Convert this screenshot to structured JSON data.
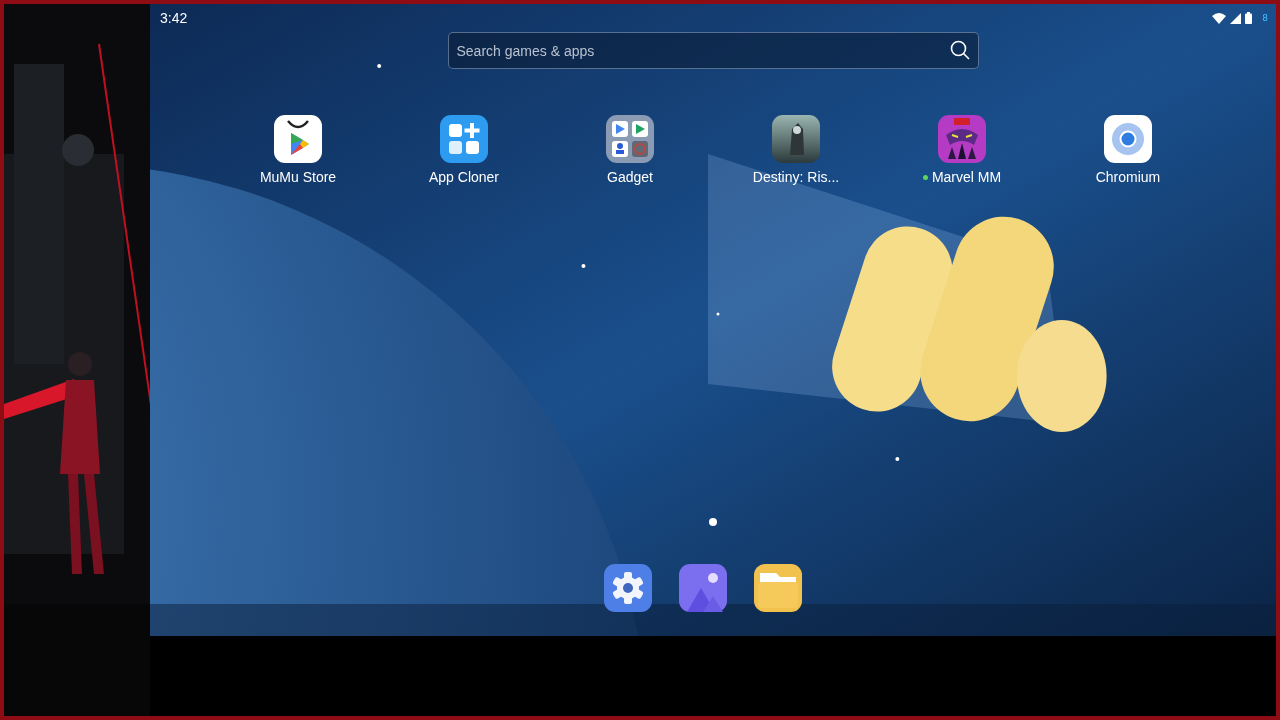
{
  "status_bar": {
    "time": "3:42",
    "badge": "8"
  },
  "search": {
    "placeholder": "Search games & apps"
  },
  "apps": [
    {
      "label": "MuMu Store",
      "kind": "store",
      "new": false
    },
    {
      "label": "App Cloner",
      "kind": "cloner",
      "new": false
    },
    {
      "label": "Gadget",
      "kind": "folder",
      "new": false
    },
    {
      "label": "Destiny: Ris...",
      "kind": "destiny",
      "new": false
    },
    {
      "label": "Marvel MM",
      "kind": "marvel",
      "new": true
    },
    {
      "label": "Chromium",
      "kind": "chromium",
      "new": false
    }
  ],
  "page_dots": [
    {
      "selected": true
    }
  ],
  "dock": [
    {
      "kind": "settings"
    },
    {
      "kind": "gallery"
    },
    {
      "kind": "files"
    }
  ]
}
